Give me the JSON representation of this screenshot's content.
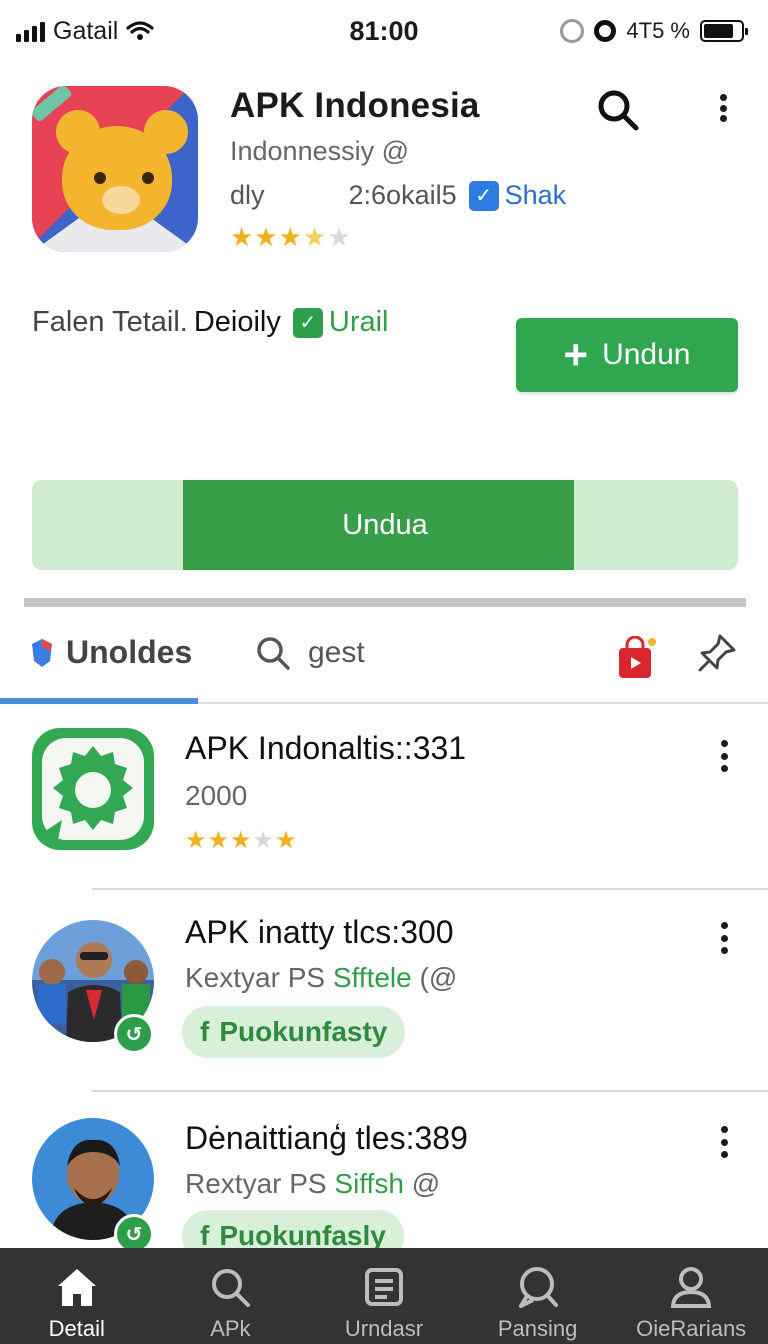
{
  "status_bar": {
    "carrier": "Gatail",
    "time": "81:00",
    "battery_text": "4T5 %"
  },
  "app": {
    "title": "APK Indonesia",
    "developer": "Indonnessiy @",
    "meta_left": "dly",
    "meta_size": "2:6okail5",
    "meta_tag": "Shak",
    "rating": 3.5
  },
  "description": {
    "label": "Falen Tetail.",
    "value": "Deioily",
    "tag": "Urail"
  },
  "install_button": {
    "label": "Undun"
  },
  "progress": {
    "label": "Undua",
    "fraction": 0.55
  },
  "tabs": {
    "tab1": "Unoldes",
    "tab2": "gest"
  },
  "list": [
    {
      "title": "APK Indonaltis::331",
      "sub": "2000",
      "rating": 3.5
    },
    {
      "title": "APK inatty tlcs:300",
      "sub_prefix": "Kextyar PS ",
      "sub_green": "Sfftele",
      "sub_suffix": " (@",
      "chip": "Puokunfasty",
      "chip_icon": "f"
    },
    {
      "title": "Dėnaittianģ tles:389",
      "sub_prefix": "Rextyar PS ",
      "sub_green": "Siffsh",
      "sub_suffix": " @",
      "chip": "Puokunfasly",
      "chip_icon": "f"
    }
  ],
  "bottom_nav": [
    {
      "label": "Detail",
      "icon": "home-icon"
    },
    {
      "label": "APk",
      "icon": "search-icon"
    },
    {
      "label": "Urndasr",
      "icon": "document-icon"
    },
    {
      "label": "Pansing",
      "icon": "chat-icon"
    },
    {
      "label": "OieRarians",
      "icon": "person-icon"
    }
  ],
  "colors": {
    "primary_green": "#2fa64f",
    "progress_track": "#cfeccf",
    "accent_blue": "#4a8fd8",
    "nav_bg": "#333333"
  }
}
